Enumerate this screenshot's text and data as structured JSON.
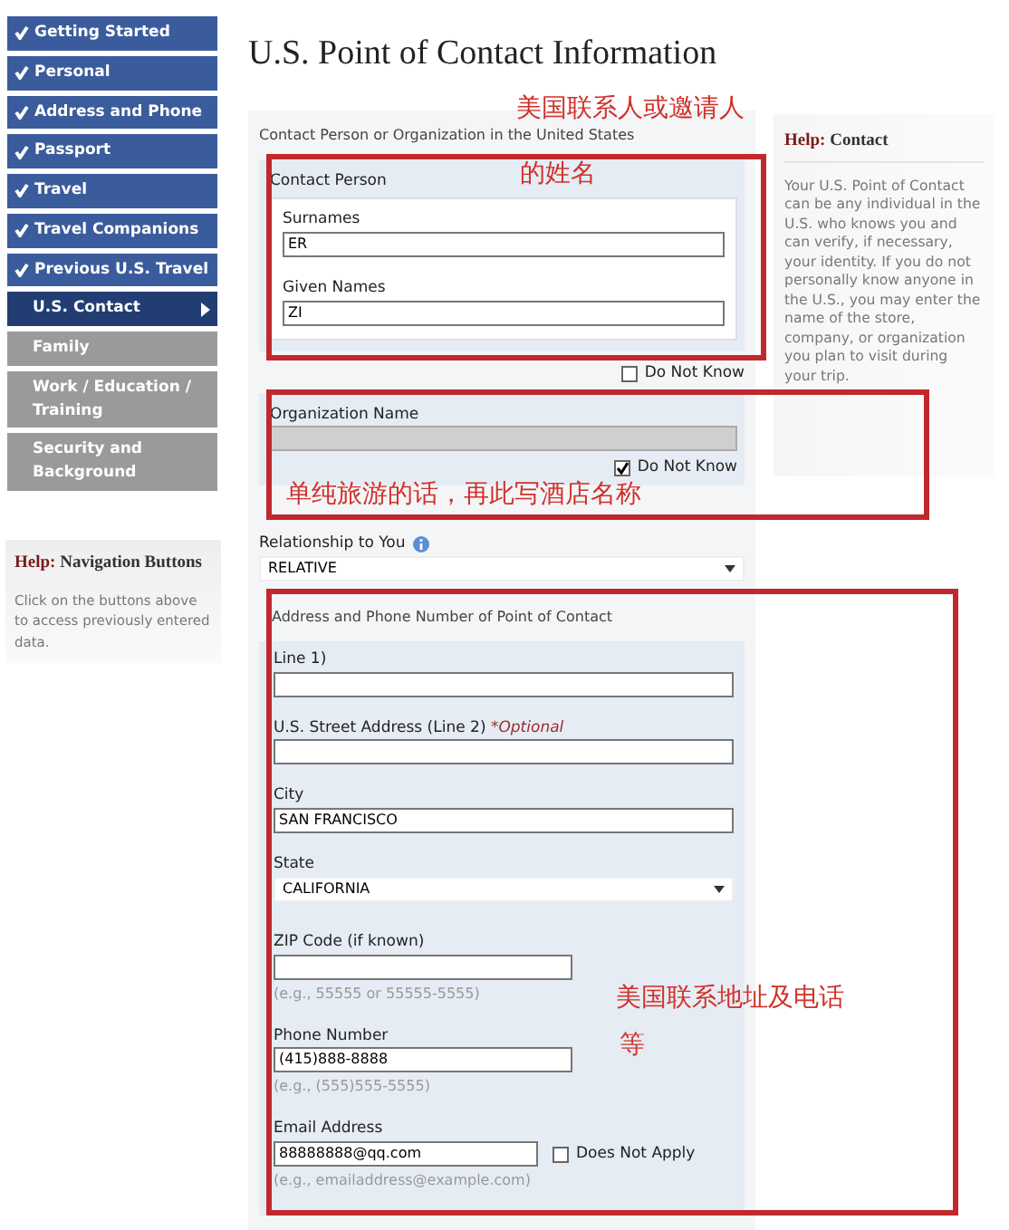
{
  "sidebar": {
    "nav_items": [
      {
        "label": "Getting Started",
        "checked": true,
        "selected": false,
        "disabled": false
      },
      {
        "label": "Personal",
        "checked": true,
        "selected": false,
        "disabled": false
      },
      {
        "label": "Address and Phone",
        "checked": true,
        "selected": false,
        "disabled": false
      },
      {
        "label": "Passport",
        "checked": true,
        "selected": false,
        "disabled": false
      },
      {
        "label": "Travel",
        "checked": true,
        "selected": false,
        "disabled": false
      },
      {
        "label": "Travel Companions",
        "checked": true,
        "selected": false,
        "disabled": false
      },
      {
        "label": "Previous U.S. Travel",
        "checked": true,
        "selected": false,
        "disabled": false
      },
      {
        "label": "U.S. Contact",
        "checked": false,
        "selected": true,
        "disabled": false
      },
      {
        "label": "Family",
        "checked": false,
        "selected": false,
        "disabled": true
      },
      {
        "label": "Work / Education / Training",
        "checked": false,
        "selected": false,
        "disabled": true
      },
      {
        "label": "Security and Background",
        "checked": false,
        "selected": false,
        "disabled": true
      }
    ],
    "help": {
      "label": "Help:",
      "topic": "Navigation Buttons",
      "text": "Click on the buttons above to access previously entered data."
    }
  },
  "page_title": "U.S. Point of Contact Information",
  "form": {
    "section_title": "Contact Person or Organization in the United States",
    "contact_person": {
      "title": "Contact Person",
      "fields": [
        {
          "label": "Surnames",
          "value": "ER"
        },
        {
          "label": "Given Names",
          "value": "ZI"
        }
      ],
      "do_not_know": {
        "label": "Do Not Know",
        "checked": false
      }
    },
    "organization": {
      "label": "Organization Name",
      "disabled": true,
      "do_not_know": {
        "label": "Do Not Know",
        "checked": true
      }
    },
    "relationship": {
      "label": "Relationship to You",
      "value": "RELATIVE"
    },
    "address": {
      "title": "Address and Phone Number of Point of Contact",
      "fields": [
        {
          "kind": "wide",
          "label": "Line 1)"
        },
        {
          "kind": "wide",
          "label": "U.S. Street Address (Line 2)",
          "note": "*Optional"
        },
        {
          "kind": "wide",
          "label": "City",
          "value": "SAN FRANCISCO"
        },
        {
          "kind": "select",
          "label": "State",
          "value": "CALIFORNIA"
        },
        {
          "kind": "narrow",
          "label": "ZIP Code (if known)",
          "hint": "(e.g., 55555 or 55555-5555)"
        },
        {
          "kind": "narrow",
          "label": "Phone Number",
          "value": "(415)888-8888",
          "hint": "(e.g., (555)555-5555)"
        },
        {
          "kind": "email",
          "label": "Email Address",
          "value": "88888888@qq.com",
          "hint": "(e.g., emailaddress@example.com)",
          "does_not_apply": {
            "label": "Does Not Apply",
            "checked": false
          }
        }
      ]
    }
  },
  "help_panel": {
    "label": "Help:",
    "topic": "Contact",
    "text": "Your U.S. Point of Contact can be any individual in the U.S. who knows you and can verify, if necessary, your identity. If you do not personally know anyone in the U.S., you may enter the name of the store, company, or organization you plan to visit during your trip."
  },
  "annotations": [
    {
      "lines": [
        "美国联系人或邀请人",
        "的姓名"
      ]
    },
    {
      "lines": [
        "单纯旅游的话，再此写酒店名称"
      ]
    },
    {
      "lines": [
        "美国联系地址及电话",
        "等"
      ]
    }
  ]
}
